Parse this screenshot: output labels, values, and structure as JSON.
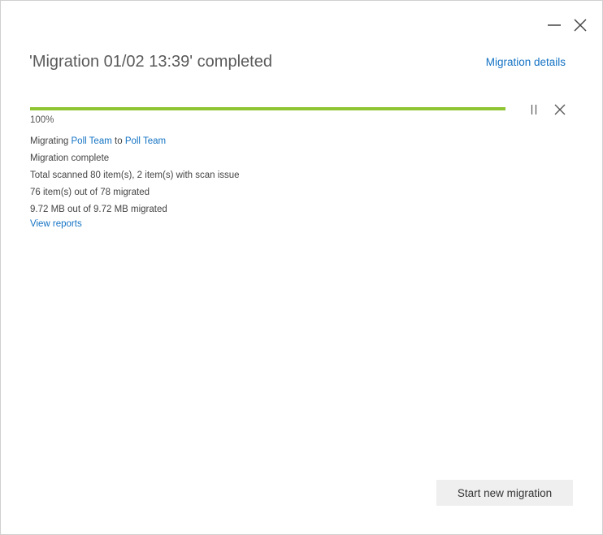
{
  "window": {
    "minimize_icon": "minimize-icon",
    "close_icon": "close-icon"
  },
  "header": {
    "title": "'Migration 01/02 13:39' completed",
    "details_link": "Migration details"
  },
  "progress": {
    "value_percent": 100,
    "label": "100%",
    "color": "#8fc432",
    "pause_icon": "pause-icon",
    "cancel_icon": "cancel-icon"
  },
  "info": {
    "migrating_prefix": "Migrating",
    "source": "Poll Team",
    "to_word": "to",
    "destination": "Poll Team",
    "status": "Migration complete",
    "scanned": "Total scanned 80 item(s), 2 item(s) with scan issue",
    "items": "76 item(s) out of 78 migrated",
    "size": "9.72 MB out of 9.72 MB migrated",
    "view_reports": "View reports"
  },
  "footer": {
    "start_button": "Start new migration"
  },
  "colors": {
    "link": "#1473c4",
    "progress": "#8fc432",
    "button_bg": "#efefef"
  }
}
